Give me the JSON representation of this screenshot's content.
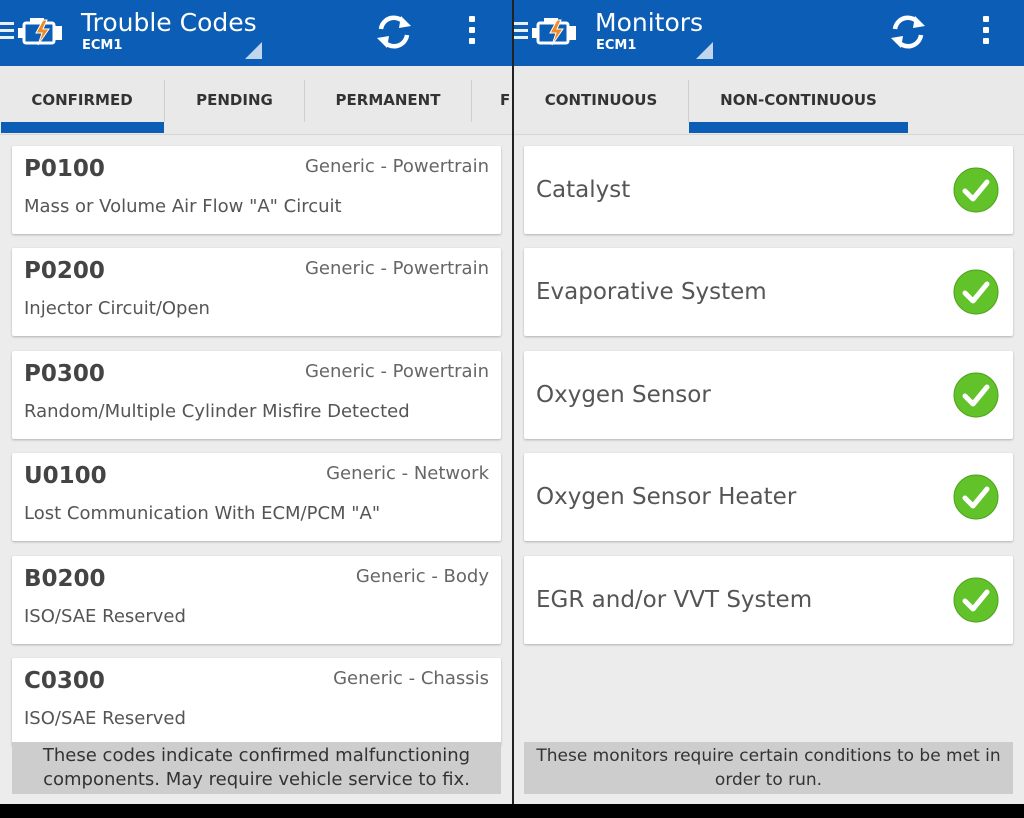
{
  "colors": {
    "primary": "#0b5db5",
    "check_green": "#62c229",
    "card_bg": "#ffffff"
  },
  "left": {
    "title": "Trouble Codes",
    "subtitle": "ECM1",
    "icons": [
      "menu-icon",
      "engine-icon",
      "refresh-icon",
      "overflow-menu-icon"
    ],
    "tabs": [
      {
        "label": "CONFIRMED",
        "selected": true
      },
      {
        "label": "PENDING",
        "selected": false
      },
      {
        "label": "PERMANENT",
        "selected": false
      },
      {
        "label": "F",
        "selected": false
      }
    ],
    "codes": [
      {
        "code": "P0100",
        "category": "Generic - Powertrain",
        "desc": "Mass or Volume Air Flow \"A\" Circuit"
      },
      {
        "code": "P0200",
        "category": "Generic - Powertrain",
        "desc": "Injector Circuit/Open"
      },
      {
        "code": "P0300",
        "category": "Generic - Powertrain",
        "desc": "Random/Multiple Cylinder Misfire Detected"
      },
      {
        "code": "U0100",
        "category": "Generic - Network",
        "desc": "Lost Communication With ECM/PCM \"A\""
      },
      {
        "code": "B0200",
        "category": "Generic - Body",
        "desc": "ISO/SAE Reserved"
      },
      {
        "code": "C0300",
        "category": "Generic - Chassis",
        "desc": "ISO/SAE Reserved"
      }
    ],
    "note_line1": "These codes indicate confirmed malfunctioning",
    "note_line2": "components. May require vehicle service to fix."
  },
  "right": {
    "title": "Monitors",
    "subtitle": "ECM1",
    "icons": [
      "menu-icon",
      "engine-icon",
      "refresh-icon",
      "overflow-menu-icon",
      "check-icon"
    ],
    "tabs": [
      {
        "label": "CONTINUOUS",
        "selected": false
      },
      {
        "label": "NON-CONTINUOUS",
        "selected": true
      }
    ],
    "monitors": [
      {
        "name": "Catalyst",
        "status": "complete"
      },
      {
        "name": "Evaporative System",
        "status": "complete"
      },
      {
        "name": "Oxygen Sensor",
        "status": "complete"
      },
      {
        "name": "Oxygen Sensor Heater",
        "status": "complete"
      },
      {
        "name": "EGR and/or VVT System",
        "status": "complete"
      }
    ],
    "note_line1": "These monitors require certain conditions to be met in",
    "note_line2": "order to run."
  }
}
